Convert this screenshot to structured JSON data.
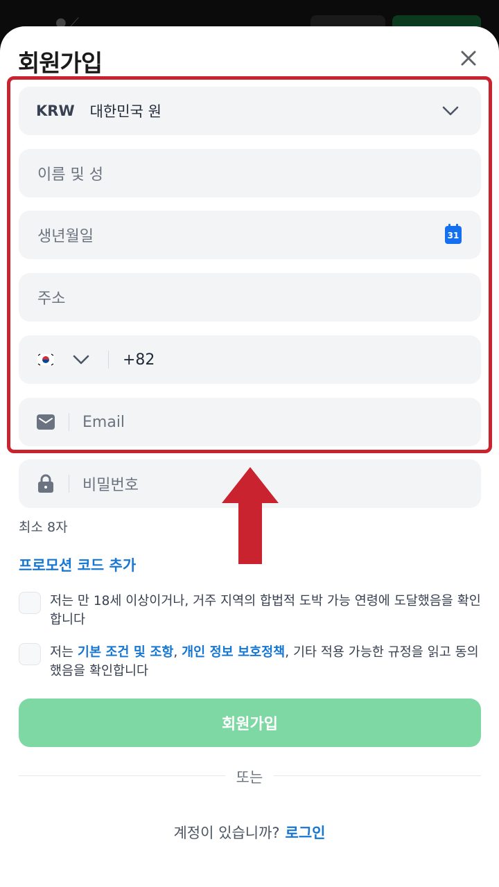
{
  "title": "회원가입",
  "currency": {
    "code": "KRW",
    "name": "대한민국 원"
  },
  "fields": {
    "name_placeholder": "이름 및 성",
    "birthdate_placeholder": "생년월일",
    "calendar_day": "31",
    "address_placeholder": "주소",
    "phone_prefix": "+82",
    "email_placeholder": "Email",
    "password_placeholder": "비밀번호"
  },
  "password_hint": "최소 8자",
  "promo_link": "프로모션 코드 추가",
  "checks": {
    "age": "저는 만 18세 이상이거나, 거주 지역의 합법적 도박 가능 연령에 도달했음을 확인합니다",
    "terms_prefix": "저는 ",
    "terms_link": "기본 조건 및 조항",
    "terms_comma": ", ",
    "privacy_link": "개인 정보 보호정책",
    "terms_suffix": ", 기타 적용 가능한 규정을 읽고 동의했음을 확인합니다"
  },
  "submit_label": "회원가입",
  "divider_text": "또는",
  "login": {
    "question": "계정이 있습니까?",
    "link": "로그인"
  },
  "colors": {
    "accent_blue": "#1677d2",
    "submit_green": "#7dd8a3",
    "highlight_red": "#c8232f",
    "calendar_blue": "#1570ef"
  }
}
